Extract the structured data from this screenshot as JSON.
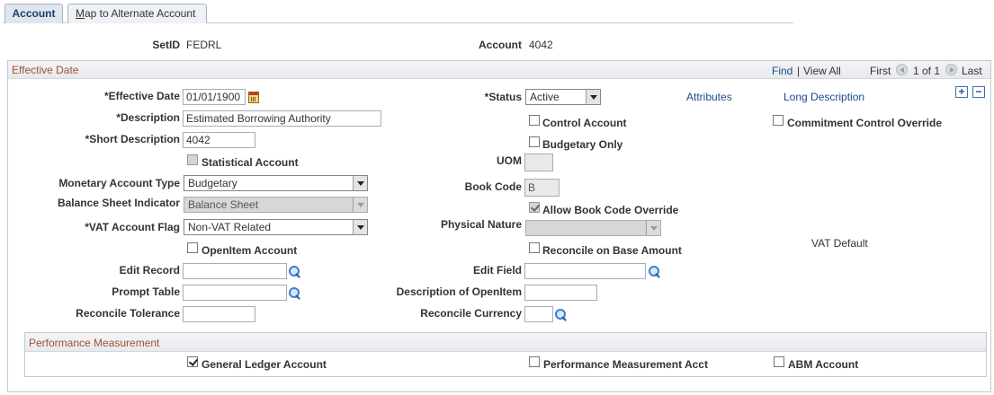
{
  "tabs": [
    {
      "label": "Account",
      "active": true
    },
    {
      "label_underlined": "M",
      "label_rest": "ap to Alternate Account",
      "active": false
    }
  ],
  "header": {
    "setid_label": "SetID",
    "setid_value": "FEDRL",
    "account_label": "Account",
    "account_value": "4042"
  },
  "effective_date_section": {
    "title": "Effective Date",
    "nav": {
      "find": "Find",
      "separator": "|",
      "view_all": "View All",
      "first": "First",
      "page_count": "1 of 1",
      "last": "Last"
    },
    "fields": {
      "effective_date_label": "*Effective Date",
      "effective_date_value": "01/01/1900",
      "status_label": "*Status",
      "status_value": "Active",
      "attributes_link": "Attributes",
      "long_description_link": "Long Description",
      "description_label": "*Description",
      "description_value": "Estimated Borrowing Authority",
      "control_account_label": "Control Account",
      "commitment_control_override_label": "Commitment Control Override",
      "short_description_label": "*Short Description",
      "short_description_value": "4042",
      "budgetary_only_label": "Budgetary Only",
      "statistical_account_label": "Statistical Account",
      "uom_label": "UOM",
      "uom_value": "",
      "monetary_account_type_label": "Monetary Account Type",
      "monetary_account_type_value": "Budgetary",
      "book_code_label": "Book Code",
      "book_code_value": "B",
      "balance_sheet_indicator_label": "Balance Sheet Indicator",
      "balance_sheet_indicator_value": "Balance Sheet",
      "allow_book_code_override_label": "Allow Book Code Override",
      "vat_account_flag_label": "*VAT Account Flag",
      "vat_account_flag_value": "Non-VAT Related",
      "physical_nature_label": "Physical Nature",
      "physical_nature_value": "",
      "openitem_account_label": "OpenItem Account",
      "reconcile_on_base_amount_label": "Reconcile on Base Amount",
      "vat_default_link": "VAT Default",
      "edit_record_label": "Edit Record",
      "edit_record_value": "",
      "edit_field_label": "Edit Field",
      "edit_field_value": "",
      "prompt_table_label": "Prompt Table",
      "prompt_table_value": "",
      "description_of_openitem_label": "Description of OpenItem",
      "description_of_openitem_value": "",
      "reconcile_tolerance_label": "Reconcile Tolerance",
      "reconcile_tolerance_value": "",
      "reconcile_currency_label": "Reconcile Currency",
      "reconcile_currency_value": ""
    },
    "checkbox_states": {
      "control_account": false,
      "commitment_control_override": false,
      "budgetary_only": false,
      "statistical_account": false,
      "allow_book_code_override": true,
      "openitem_account": false,
      "reconcile_on_base_amount": false
    },
    "row_buttons": {
      "add": "+",
      "delete": "−"
    }
  },
  "performance_measurement": {
    "title": "Performance Measurement",
    "general_ledger_account_label": "General Ledger Account",
    "performance_measurement_acct_label": "Performance Measurement Acct",
    "abm_account_label": "ABM Account",
    "checkbox_states": {
      "general_ledger_account": true,
      "performance_measurement_acct": false,
      "abm_account": false
    }
  },
  "colors": {
    "section_title": "#a0522d",
    "link": "#1c4c8c",
    "active_tab_bg": "#dfe6ef"
  }
}
